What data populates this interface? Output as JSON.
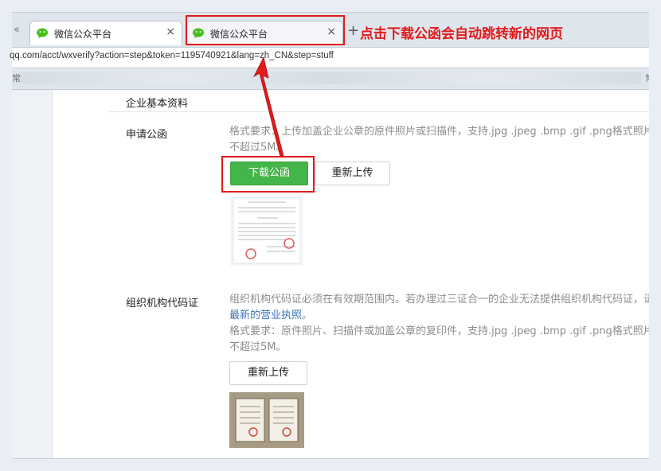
{
  "browser": {
    "tabs": [
      {
        "title": "微信公众平台",
        "close": "×"
      },
      {
        "title": "微信公众平台",
        "close": "×"
      }
    ],
    "new_tab": "+",
    "prev_arrow": "«",
    "url": "qq.com/acct/wxverify?action=step&token=1195740921&lang=zh_CN&step=stuff",
    "bookmark_left": "常",
    "bookmark_right": "常"
  },
  "annotation": {
    "text": "点击下载公函会自动跳转新的网页",
    "color": "#e21b1b"
  },
  "page": {
    "section_title": "企业基本资料",
    "letter": {
      "label": "申请公函",
      "desc_line1": "格式要求：上传加盖企业公章的原件照片或扫描件，支持.jpg .jpeg .bmp .gif .png格式照片，",
      "desc_line2": "不超过5M。",
      "download_button": "下载公函",
      "reupload_button": "重新上传"
    },
    "org_code": {
      "label": "组织机构代码证",
      "desc_line1": "组织机构代码证必须在有效期范围内。若办理过三证合一的企业无法提供组织机构代码证，请",
      "link": "最新的营业执照",
      "link_suffix": "。",
      "desc_line3": "格式要求：原件照片、扫描件或加盖公章的复印件，支持.jpg .jpeg .bmp .gif .png格式照片，",
      "desc_line4": "不超过5M。",
      "reupload_button": "重新上传"
    }
  },
  "colors": {
    "accent_green": "#44b549",
    "link_blue": "#3b73b9",
    "annotation_red": "#e21b1b"
  }
}
